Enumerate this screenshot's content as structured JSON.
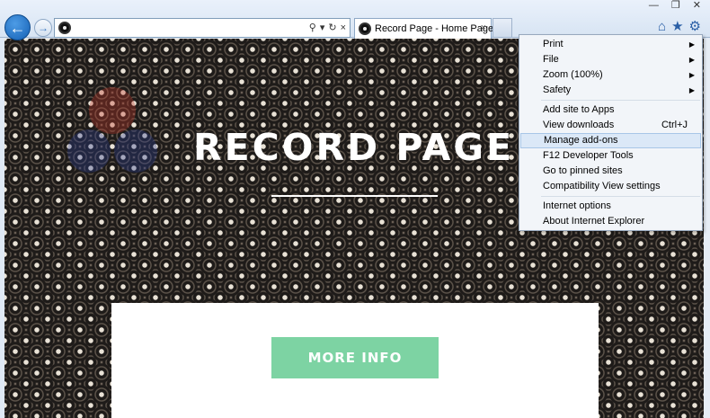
{
  "browser": {
    "tab_title": "Record Page - Home Page",
    "address_value": "",
    "tab_close": "×",
    "win_min": "—",
    "win_max": "❐",
    "win_close": "✕",
    "search_glyph": "⚲",
    "dropdown_glyph": "▾",
    "refresh_glyph": "↻",
    "addr_close_glyph": "×",
    "home_glyph": "⌂",
    "star_glyph": "★",
    "gear_glyph": "⚙",
    "back_glyph": "←",
    "forward_glyph": "→"
  },
  "page": {
    "hero_title": "RECORD PAGE",
    "more_info": "MORE INFO",
    "button_color": "#7dd3a3"
  },
  "tools_menu": {
    "items": [
      {
        "label": "Print",
        "submenu": true
      },
      {
        "label": "File",
        "submenu": true
      },
      {
        "label": "Zoom (100%)",
        "submenu": true
      },
      {
        "label": "Safety",
        "submenu": true
      },
      {
        "label": "Add site to Apps"
      },
      {
        "label": "View downloads",
        "shortcut": "Ctrl+J"
      },
      {
        "label": "Manage add-ons",
        "highlighted": true
      },
      {
        "label": "F12 Developer Tools"
      },
      {
        "label": "Go to pinned sites"
      },
      {
        "label": "Compatibility View settings"
      },
      {
        "label": "Internet options"
      },
      {
        "label": "About Internet Explorer"
      }
    ],
    "arrow_glyph": "▶"
  }
}
